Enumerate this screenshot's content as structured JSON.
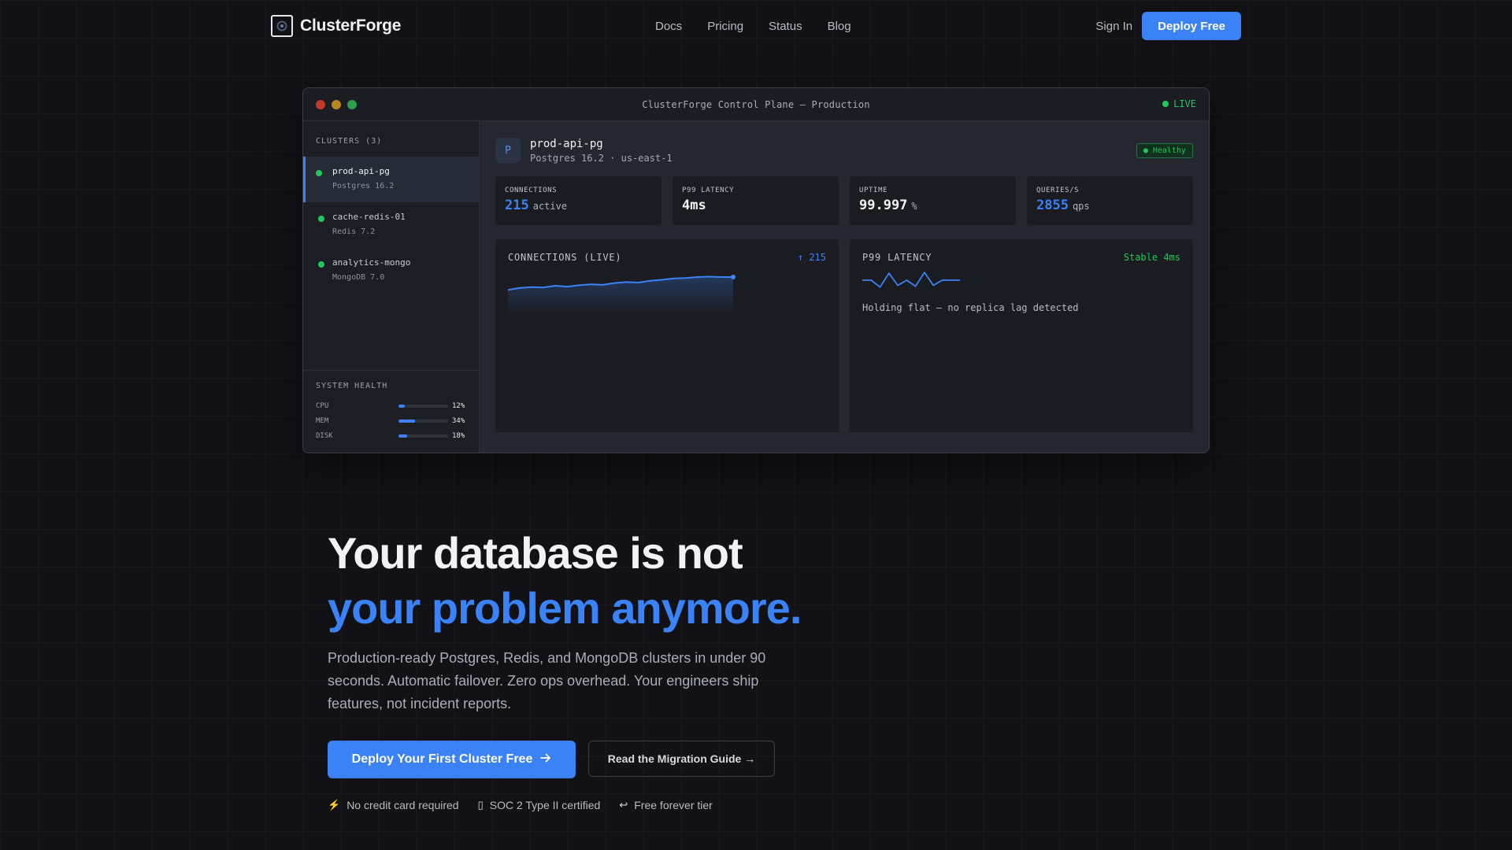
{
  "nav": {
    "brand": "ClusterForge",
    "links": [
      "Docs",
      "Pricing",
      "Status",
      "Blog"
    ],
    "sign_in": "Sign In",
    "deploy": "Deploy Free"
  },
  "window": {
    "title": "ClusterForge Control Plane — Production",
    "live_label": "LIVE",
    "colors": {
      "close": "#c0392b",
      "minimize": "#b8861b",
      "maximize": "#2aa14a"
    }
  },
  "sidebar": {
    "heading": "CLUSTERS (3)",
    "clusters": [
      {
        "name": "prod-api-pg",
        "version": "Postgres 16.2",
        "status": "healthy"
      },
      {
        "name": "cache-redis-01",
        "version": "Redis 7.2",
        "status": "healthy"
      },
      {
        "name": "analytics-mongo",
        "version": "MongoDB 7.0",
        "status": "healthy"
      }
    ],
    "health": {
      "title": "SYSTEM HEALTH",
      "rows": [
        {
          "label": "CPU",
          "value": "12%",
          "pct": 12
        },
        {
          "label": "MEM",
          "value": "34%",
          "pct": 34
        },
        {
          "label": "DISK",
          "value": "18%",
          "pct": 18
        }
      ]
    }
  },
  "db": {
    "icon_letter": "P",
    "name": "prod-api-pg",
    "subtitle": "Postgres 16.2 · us-east-1",
    "badge": "● Healthy"
  },
  "metrics": [
    {
      "label": "CONNECTIONS",
      "value": "215",
      "unit": "active",
      "accent": "blue"
    },
    {
      "label": "P99 LATENCY",
      "value": "4ms",
      "unit": "",
      "accent": "white"
    },
    {
      "label": "UPTIME",
      "value": "99.997",
      "unit": "%",
      "accent": "white"
    },
    {
      "label": "QUERIES/S",
      "value": "2855",
      "unit": "qps",
      "accent": "blue"
    }
  ],
  "charts": {
    "connections": {
      "title": "CONNECTIONS (LIVE)",
      "stat": "↑ 215",
      "values": [
        180,
        184,
        186,
        185,
        189,
        187,
        190,
        192,
        191,
        195,
        197,
        196,
        200,
        202,
        205,
        206,
        208,
        209,
        208,
        208
      ]
    },
    "latency": {
      "title": "P99 LATENCY",
      "stat": "Stable 4ms",
      "note": "Holding flat — no replica lag detected",
      "values": [
        4.0,
        4.0,
        3.2,
        4.8,
        3.4,
        4.0,
        3.3,
        4.9,
        3.4,
        4.0,
        4.0,
        4.0
      ]
    }
  },
  "hero": {
    "line1": "Your database is not",
    "line2": "your problem anymore.",
    "lead": "Production-ready Postgres, Redis, and MongoDB clusters in under 90 seconds. Automatic failover. Zero ops overhead. Your engineers ship features, not incident reports.",
    "cta_primary": "Deploy Your First Cluster Free",
    "cta_secondary": "Read the Migration Guide →",
    "trust": [
      {
        "icon": "⚡",
        "icon_name": "lightning-icon",
        "text": "No credit card required"
      },
      {
        "icon": "▯",
        "icon_name": "shield-icon",
        "text": "SOC 2 Type II certified"
      },
      {
        "icon": "↩",
        "icon_name": "return-icon",
        "text": "Free forever tier"
      }
    ]
  }
}
